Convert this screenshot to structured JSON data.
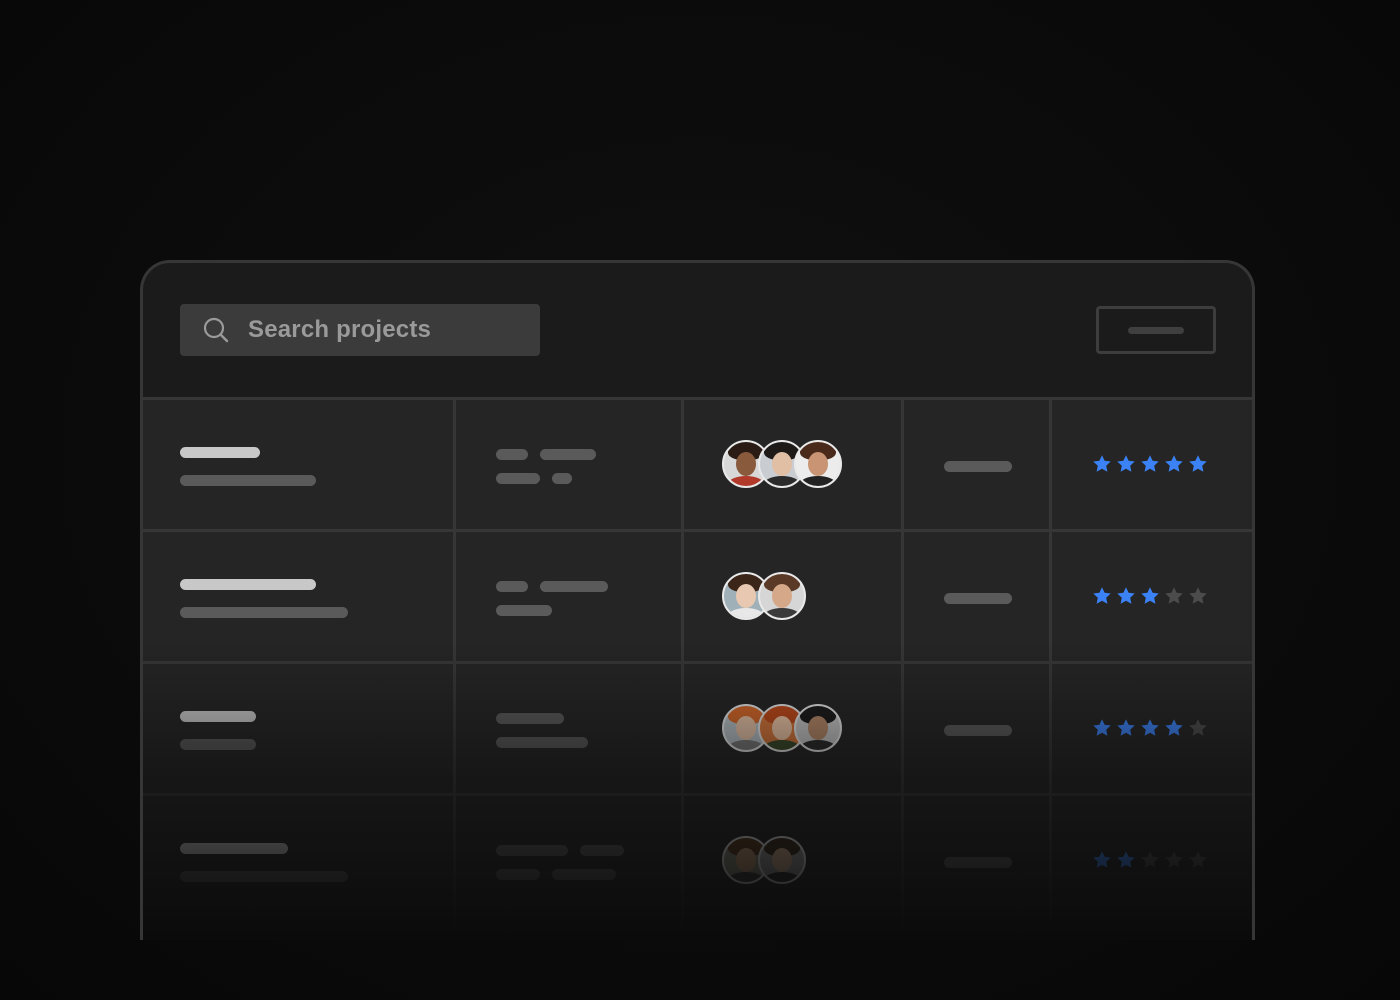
{
  "search": {
    "placeholder": "Search projects",
    "icon": "search-icon"
  },
  "toolbar": {
    "action_icon": "dash-icon"
  },
  "rows": [
    {
      "avatars": [
        "avatar-1a",
        "avatar-1b",
        "avatar-1c"
      ],
      "rating": 5
    },
    {
      "avatars": [
        "avatar-2a",
        "avatar-2b"
      ],
      "rating": 3
    },
    {
      "avatars": [
        "avatar-3a",
        "avatar-3b",
        "avatar-3c"
      ],
      "rating": 4
    },
    {
      "avatars": [
        "avatar-4a",
        "avatar-4b"
      ],
      "rating": 2
    }
  ],
  "rating_max": 5,
  "colors": {
    "star_active": "#3b82f6",
    "star_inactive": "#4c4c4c",
    "background": "#0b0b0b",
    "panel": "#1b1b1b",
    "cell": "#252525",
    "border": "#363636"
  }
}
